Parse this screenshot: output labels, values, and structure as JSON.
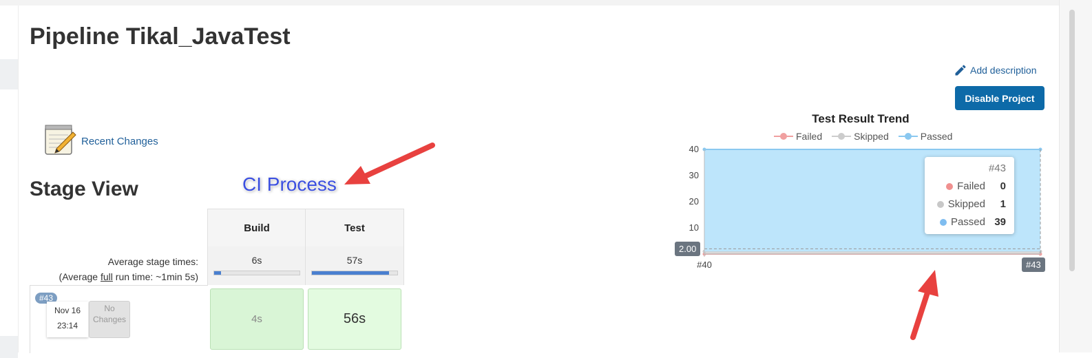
{
  "page": {
    "title": "Pipeline Tikal_JavaTest",
    "add_description": "Add description",
    "disable_project": "Disable Project",
    "recent_changes": "Recent Changes"
  },
  "stage_view": {
    "heading": "Stage View",
    "annotation": "CI Process",
    "columns": [
      {
        "name": "Build",
        "avg_time": "6s",
        "avg_fill": 0.08
      },
      {
        "name": "Test",
        "avg_time": "57s",
        "avg_fill": 0.9
      }
    ],
    "avg_label_line1": "Average stage times:",
    "avg_label_line2_prefix": "(Average ",
    "avg_label_line2_underlined": "full",
    "avg_label_line2_suffix": " run time: ~1min 5s)",
    "run": {
      "badge": "#43",
      "date": "Nov 16",
      "time": "23:14",
      "changes_line1": "No",
      "changes_line2": "Changes",
      "durations": [
        "4s",
        "56s"
      ]
    }
  },
  "chart_data": {
    "type": "area",
    "title": "Test Result Trend",
    "legend": [
      "Failed",
      "Skipped",
      "Passed"
    ],
    "legend_position": "top",
    "x": [
      "#40",
      "#43"
    ],
    "series": [
      {
        "name": "Failed",
        "values": [
          0,
          0
        ],
        "color": "#f0a0a0"
      },
      {
        "name": "Skipped",
        "values": [
          1,
          1
        ],
        "color": "#cccccc"
      },
      {
        "name": "Passed",
        "values": [
          39,
          39
        ],
        "color": "#8ac8f0"
      }
    ],
    "y_ticks": [
      "40",
      "30",
      "20",
      "10"
    ],
    "ylim": [
      0,
      40
    ],
    "crosshair_y_label": "2.00",
    "crosshair_x_label": "#43",
    "tooltip": {
      "title": "#43",
      "rows": [
        {
          "label": "Failed",
          "value": "0",
          "color": "#f0908f"
        },
        {
          "label": "Skipped",
          "value": "1",
          "color": "#c8c8c8"
        },
        {
          "label": "Passed",
          "value": "39",
          "color": "#7fbdf0"
        }
      ]
    }
  },
  "colors": {
    "accent": "#0d6aa8",
    "link": "#1f5f99",
    "annotation_arrow": "#e8413f",
    "passed_fill": "#bde5fb"
  }
}
